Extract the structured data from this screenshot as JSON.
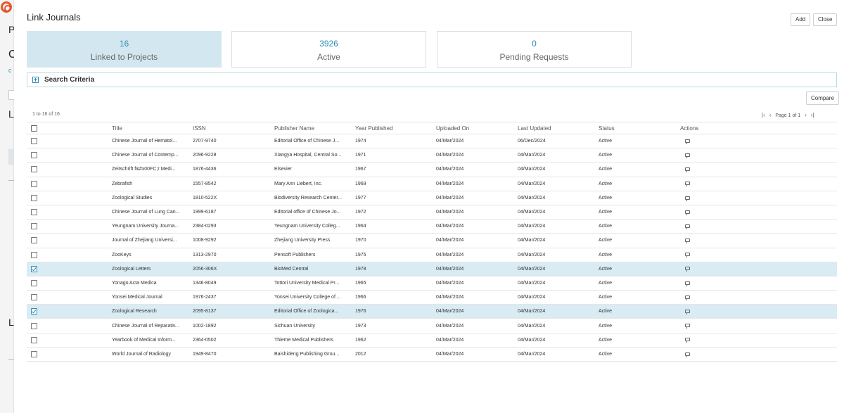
{
  "background": {
    "letters": [
      "P",
      "C",
      "c",
      "L",
      "L"
    ]
  },
  "modal": {
    "title": "Link Journals",
    "add_label": "Add",
    "close_label": "Close"
  },
  "stats": [
    {
      "value": "16",
      "label": "Linked to Projects"
    },
    {
      "value": "3926",
      "label": "Active"
    },
    {
      "value": "0",
      "label": "Pending Requests"
    }
  ],
  "search": {
    "label": "Search Criteria"
  },
  "compare_label": "Compare",
  "results": {
    "count_text": "1 to 16 of 16",
    "page_text": "Page 1 of 1"
  },
  "colors": {
    "accent": "#2b8db5",
    "selected_row": "#d9ebf3",
    "active_card": "#d3e7f0"
  },
  "table": {
    "columns": [
      "Title",
      "ISSN",
      "Publisher Name",
      "Year Published",
      "Uploaded On",
      "Last Updated",
      "Status",
      "Actions"
    ],
    "rows": [
      {
        "checked": false,
        "title": "Chinese Journal of Hematol...",
        "issn": "2707-9740",
        "publisher": "Editorial Office of Chinese J...",
        "year": "1974",
        "uploaded": "04/Mar/2024",
        "updated": "06/Dec/2024",
        "status": "Active"
      },
      {
        "checked": false,
        "title": "Chinese Journal of Contemp...",
        "issn": "2096-9228",
        "publisher": "Xiangya Hospital, Central So...",
        "year": "1971",
        "uploaded": "04/Mar/2024",
        "updated": "04/Mar/2024",
        "status": "Active"
      },
      {
        "checked": false,
        "title": "Zeitschrift f&#x00FC;r Medi...",
        "issn": "1876-4436",
        "publisher": "Elsevier",
        "year": "1967",
        "uploaded": "04/Mar/2024",
        "updated": "04/Mar/2024",
        "status": "Active"
      },
      {
        "checked": false,
        "title": "Zebrafish",
        "issn": "1557-8542",
        "publisher": "Mary Ann Liebert, Inc.",
        "year": "1969",
        "uploaded": "04/Mar/2024",
        "updated": "04/Mar/2024",
        "status": "Active"
      },
      {
        "checked": false,
        "title": "Zoological Studies",
        "issn": "1810-522X",
        "publisher": "Biodiversity Research Center...",
        "year": "1977",
        "uploaded": "04/Mar/2024",
        "updated": "04/Mar/2024",
        "status": "Active"
      },
      {
        "checked": false,
        "title": "Chinese Journal of Lung Can...",
        "issn": "1999-6187",
        "publisher": "Editorial office of Chinese Jo...",
        "year": "1972",
        "uploaded": "04/Mar/2024",
        "updated": "04/Mar/2024",
        "status": "Active"
      },
      {
        "checked": false,
        "title": "Yeungnam University Journa...",
        "issn": "2384-0293",
        "publisher": "Yeungnam University Colleg...",
        "year": "1964",
        "uploaded": "04/Mar/2024",
        "updated": "04/Mar/2024",
        "status": "Active"
      },
      {
        "checked": false,
        "title": "Journal of Zhejiang Universi...",
        "issn": "1008-9292",
        "publisher": "Zhejiang University Press",
        "year": "1970",
        "uploaded": "04/Mar/2024",
        "updated": "04/Mar/2024",
        "status": "Active"
      },
      {
        "checked": false,
        "title": "ZooKeys",
        "issn": "1313-2970",
        "publisher": "Pensoft Publishers",
        "year": "1975",
        "uploaded": "04/Mar/2024",
        "updated": "04/Mar/2024",
        "status": "Active"
      },
      {
        "checked": true,
        "title": "Zoological Letters",
        "issn": "2056-306X",
        "publisher": "BioMed Central",
        "year": "1978",
        "uploaded": "04/Mar/2024",
        "updated": "04/Mar/2024",
        "status": "Active"
      },
      {
        "checked": false,
        "title": "Yonago Acta Medica",
        "issn": "1346-8049",
        "publisher": "Tottori University Medical Pr...",
        "year": "1965",
        "uploaded": "04/Mar/2024",
        "updated": "04/Mar/2024",
        "status": "Active"
      },
      {
        "checked": false,
        "title": "Yonsei Medical Journal",
        "issn": "1976-2437",
        "publisher": "Yonsei University College of ...",
        "year": "1966",
        "uploaded": "04/Mar/2024",
        "updated": "04/Mar/2024",
        "status": "Active"
      },
      {
        "checked": true,
        "title": "Zoological Research",
        "issn": "2095-8137",
        "publisher": "Editorial Office of Zoologica...",
        "year": "1976",
        "uploaded": "04/Mar/2024",
        "updated": "04/Mar/2024",
        "status": "Active"
      },
      {
        "checked": false,
        "title": "Chinese Journal of Reparativ...",
        "issn": "1002-1892",
        "publisher": "Sichuan University",
        "year": "1973",
        "uploaded": "04/Mar/2024",
        "updated": "04/Mar/2024",
        "status": "Active"
      },
      {
        "checked": false,
        "title": "Yearbook of Medical Inform...",
        "issn": "2364-0502",
        "publisher": "Thieme Medical Publishers",
        "year": "1962",
        "uploaded": "04/Mar/2024",
        "updated": "04/Mar/2024",
        "status": "Active"
      },
      {
        "checked": false,
        "title": "World Journal of Radiology",
        "issn": "1949-8470",
        "publisher": "Baishideng Publishing Grou...",
        "year": "2012",
        "uploaded": "04/Mar/2024",
        "updated": "04/Mar/2024",
        "status": "Active"
      }
    ]
  }
}
